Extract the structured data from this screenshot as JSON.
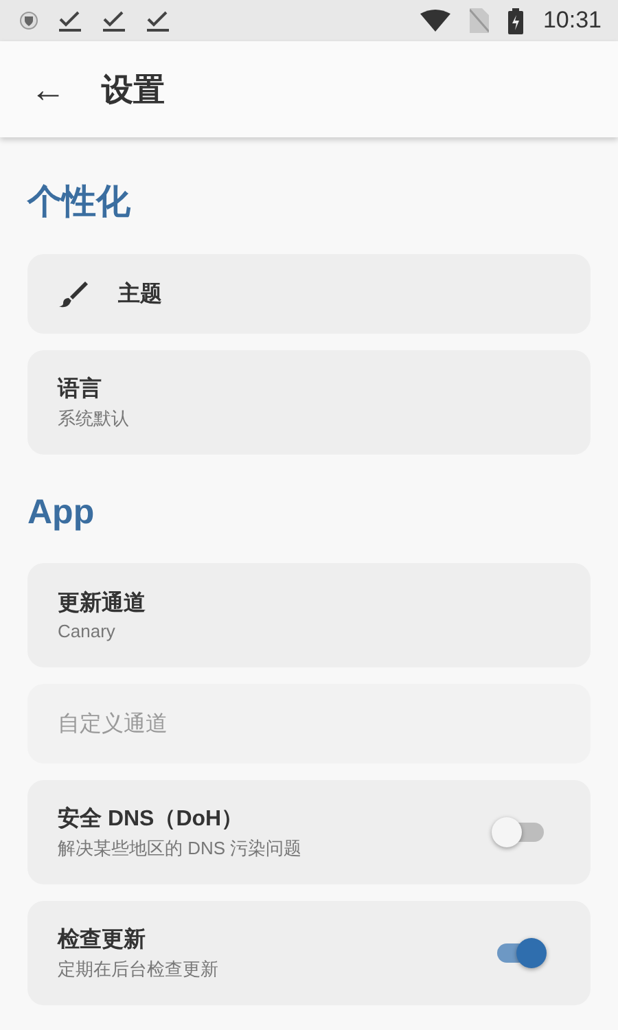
{
  "status_bar": {
    "time": "10:31"
  },
  "app_bar": {
    "back": "←",
    "title": "设置"
  },
  "sections": [
    {
      "title": "个性化",
      "items": [
        {
          "kind": "icon",
          "title": "主题"
        },
        {
          "kind": "text",
          "title": "语言",
          "summary": "系统默认"
        }
      ]
    },
    {
      "title": "App",
      "items": [
        {
          "kind": "text",
          "title": "更新通道",
          "summary": "Canary",
          "disabled": false
        },
        {
          "kind": "text",
          "title": "自定义通道",
          "disabled": true
        },
        {
          "kind": "switch",
          "title": "安全 DNS（DoH）",
          "summary": "解决某些地区的 DNS 污染问题",
          "on": false
        },
        {
          "kind": "switch",
          "title": "检查更新",
          "summary": "定期在后台检查更新",
          "on": true
        }
      ]
    }
  ]
}
